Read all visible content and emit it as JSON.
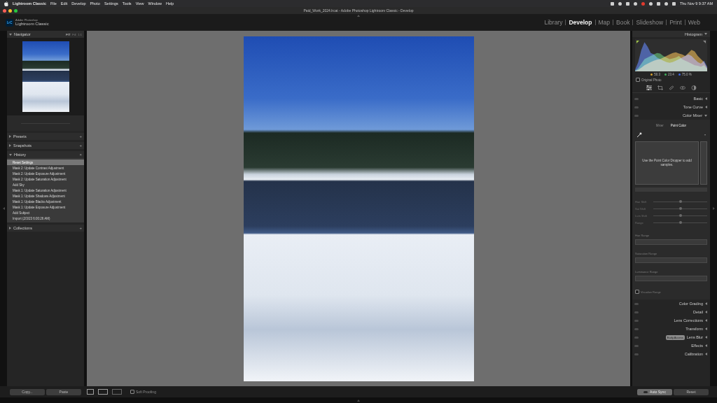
{
  "menu_bar": {
    "app_name": "Lightroom Classic",
    "items": [
      "File",
      "Edit",
      "Develop",
      "Photo",
      "Settings",
      "Tools",
      "View",
      "Window",
      "Help"
    ],
    "clock": "Thu Nov 9  9:37 AM"
  },
  "window": {
    "title": "Paid_Work_2024.lrcat - Adobe Photoshop Lightroom Classic - Develop"
  },
  "identity_plate": {
    "logo": "LrC",
    "line1": "Adobe Photoshop",
    "line2": "Lightroom Classic"
  },
  "modules": [
    {
      "label": "Library",
      "selected": false
    },
    {
      "label": "Develop",
      "selected": true
    },
    {
      "label": "Map",
      "selected": false
    },
    {
      "label": "Book",
      "selected": false
    },
    {
      "label": "Slideshow",
      "selected": false
    },
    {
      "label": "Print",
      "selected": false
    },
    {
      "label": "Web",
      "selected": false
    }
  ],
  "navigator": {
    "title": "Navigator",
    "expanded": true,
    "zoom_options": [
      {
        "label": "FIT",
        "selected": true
      },
      {
        "label": "Fill",
        "selected": false
      },
      {
        "label": "1:1",
        "selected": false
      }
    ]
  },
  "left_sections": [
    {
      "title": "Presets",
      "expanded": false,
      "action": "+"
    },
    {
      "title": "Snapshots",
      "expanded": false,
      "action": "+"
    },
    {
      "title": "History",
      "expanded": true,
      "action": "×"
    },
    {
      "title": "Collections",
      "expanded": false,
      "action": "+"
    }
  ],
  "history": [
    {
      "label": "Reset Settings",
      "selected": true
    },
    {
      "label": "Mask 2: Update Contrast Adjustment",
      "selected": false
    },
    {
      "label": "Mask 2: Update Exposure Adjustment",
      "selected": false
    },
    {
      "label": "Mask 2: Update Saturation Adjustment",
      "selected": false
    },
    {
      "label": "Add Sky",
      "selected": false
    },
    {
      "label": "Mask 1: Update Saturation Adjustment",
      "selected": false
    },
    {
      "label": "Mask 1: Update Shadows Adjustment",
      "selected": false
    },
    {
      "label": "Mask 1: Update Blacks Adjustment",
      "selected": false
    },
    {
      "label": "Mask 1: Update Exposure Adjustment",
      "selected": false
    },
    {
      "label": "Add Subject",
      "selected": false
    },
    {
      "label": "Import (2/3/23 6:00:26 AM)",
      "selected": false
    }
  ],
  "histogram": {
    "title": "Histogram",
    "expanded": true,
    "readings": [
      "50.3",
      "23.4",
      "75.0 %"
    ],
    "series": [
      {
        "name": "blue",
        "color": "#3c64e0",
        "values": [
          5,
          30,
          70,
          95,
          80,
          60,
          55,
          45,
          40,
          35,
          30,
          28,
          30,
          35,
          40,
          45,
          50,
          55,
          50,
          40,
          30,
          25,
          35,
          15
        ]
      },
      {
        "name": "green",
        "color": "#3fae5a",
        "values": [
          2,
          10,
          25,
          40,
          45,
          50,
          55,
          60,
          58,
          50,
          45,
          40,
          42,
          45,
          50,
          40,
          35,
          30,
          25,
          20,
          18,
          15,
          20,
          8
        ]
      },
      {
        "name": "red",
        "color": "#d8a02c",
        "values": [
          1,
          5,
          12,
          20,
          25,
          30,
          35,
          38,
          40,
          45,
          50,
          55,
          60,
          62,
          58,
          55,
          50,
          60,
          70,
          65,
          50,
          40,
          30,
          10
        ]
      }
    ],
    "original_photo": {
      "label": "Original Photo",
      "checked": false
    }
  },
  "right_panels_top": [
    {
      "title": "Basic",
      "expanded": false
    },
    {
      "title": "Tone Curve",
      "expanded": false
    },
    {
      "title": "Color Mixer",
      "expanded": true
    }
  ],
  "color_mixer": {
    "tabs": [
      {
        "label": "Mixer",
        "selected": false
      },
      {
        "label": "Point Color",
        "selected": true
      }
    ],
    "hint": "Use the Point Color Dropper to add samples.",
    "sliders": [
      {
        "label": "Hue Shift",
        "level": 0.5,
        "disabled": true
      },
      {
        "label": "Sat Shift",
        "level": 0.5,
        "disabled": true
      },
      {
        "label": "Lum Shift",
        "level": 0.5,
        "disabled": true
      },
      {
        "label": "Range",
        "level": 0.5,
        "disabled": true
      }
    ],
    "ranges": [
      {
        "label": "Hue Range"
      },
      {
        "label": "Saturation Range"
      },
      {
        "label": "Luminance Range"
      }
    ],
    "visualize": {
      "label": "Visualize Range",
      "checked": false
    }
  },
  "right_panels_bottom": [
    {
      "title": "Color Grading",
      "expanded": false
    },
    {
      "title": "Detail",
      "expanded": false
    },
    {
      "title": "Lens Corrections",
      "expanded": false
    },
    {
      "title": "Transform",
      "expanded": false
    },
    {
      "title": "Lens Blur",
      "expanded": false,
      "badge": "Early Access"
    },
    {
      "title": "Effects",
      "expanded": false
    },
    {
      "title": "Calibration",
      "expanded": false
    }
  ],
  "toolbar": {
    "copy": "Copy...",
    "paste": "Paste",
    "soft_proofing": {
      "label": "Soft Proofing",
      "checked": false
    },
    "auto_sync": {
      "label": "Auto Sync",
      "on": false
    },
    "reset": "Reset"
  }
}
